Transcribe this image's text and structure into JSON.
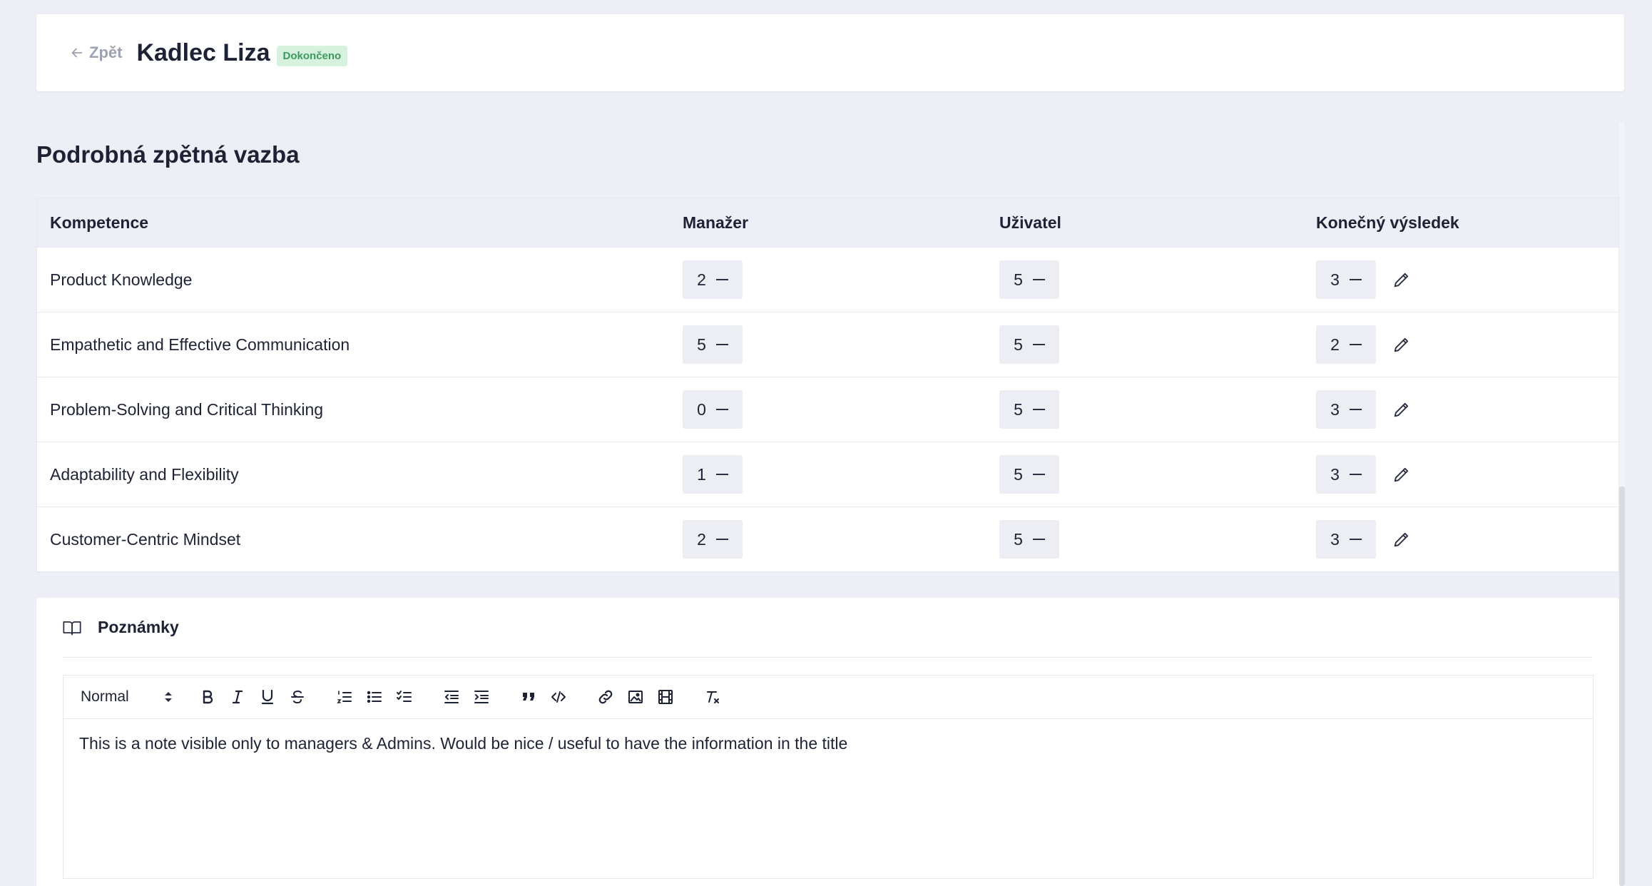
{
  "header": {
    "back_label": "Zpět",
    "title": "Kadlec Liza",
    "status": "Dokončeno"
  },
  "section": {
    "title": "Podrobná zpětná vazba"
  },
  "table": {
    "headers": {
      "competence": "Kompetence",
      "manager": "Manažer",
      "user": "Uživatel",
      "final": "Konečný výsledek"
    },
    "rows": [
      {
        "competence": "Product Knowledge",
        "manager": "2",
        "user": "5",
        "final": "3"
      },
      {
        "competence": "Empathetic and Effective Communication",
        "manager": "5",
        "user": "5",
        "final": "2"
      },
      {
        "competence": "Problem-Solving and Critical Thinking",
        "manager": "0",
        "user": "5",
        "final": "3"
      },
      {
        "competence": "Adaptability and Flexibility",
        "manager": "1",
        "user": "5",
        "final": "3"
      },
      {
        "competence": "Customer-Centric Mindset",
        "manager": "2",
        "user": "5",
        "final": "3"
      }
    ]
  },
  "notes": {
    "title": "Poznámky",
    "format": "Normal",
    "content": "This is a note visible only to managers & Admins. Would be nice / useful to have the information in the title"
  },
  "colors": {
    "page_bg": "#eeeff6",
    "badge_bg": "#d6f2de",
    "badge_text": "#3e9a5c",
    "text": "#1e2235"
  }
}
